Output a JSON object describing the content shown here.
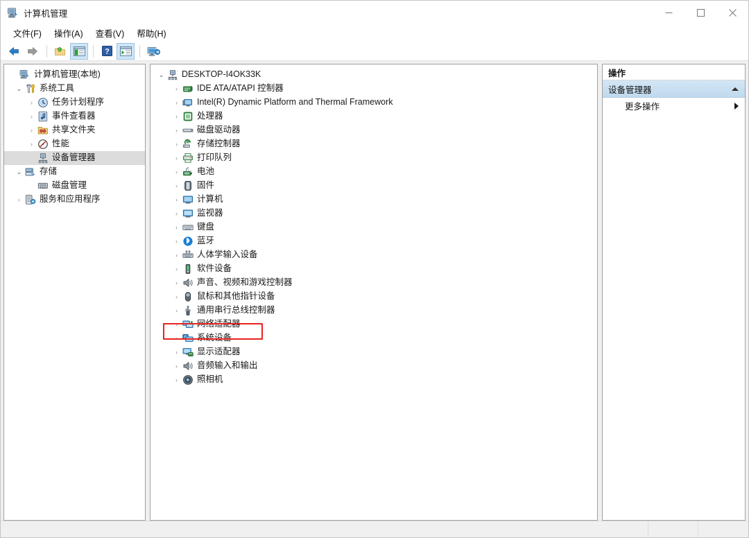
{
  "window": {
    "title": "计算机管理",
    "app_icon": "computer-management-icon",
    "controls": {
      "minimize": "–",
      "maximize": "□",
      "close": "✕"
    }
  },
  "menubar": {
    "items": [
      {
        "label": "文件(F)",
        "name": "menu-file"
      },
      {
        "label": "操作(A)",
        "name": "menu-action"
      },
      {
        "label": "查看(V)",
        "name": "menu-view"
      },
      {
        "label": "帮助(H)",
        "name": "menu-help"
      }
    ]
  },
  "toolbar": {
    "buttons": [
      {
        "name": "back-button",
        "icon": "arrow-left-icon",
        "pressed": false,
        "tip": "后退"
      },
      {
        "name": "forward-button",
        "icon": "arrow-right-icon",
        "pressed": false,
        "tip": "前进"
      },
      {
        "name": "up-level-button",
        "icon": "folder-up-icon",
        "pressed": false,
        "tip": "上移一级"
      },
      {
        "name": "show-hide-tree-button",
        "icon": "console-tree-icon",
        "pressed": true,
        "tip": "显示/隐藏控制台树"
      },
      {
        "name": "help-button",
        "icon": "help-question-icon",
        "pressed": false,
        "tip": "帮助"
      },
      {
        "name": "show-action-pane-button",
        "icon": "action-pane-icon",
        "pressed": true,
        "tip": "显示/隐藏操作窗格"
      },
      {
        "name": "remote-desktop-button",
        "icon": "remote-computer-icon",
        "pressed": false,
        "tip": "连接到另一台计算机"
      }
    ]
  },
  "console_tree": {
    "items": [
      {
        "label": "计算机管理(本地)",
        "icon": "computer-management-icon",
        "indent": 0,
        "state": "none",
        "selected": false
      },
      {
        "label": "系统工具",
        "icon": "system-tools-icon",
        "indent": 1,
        "state": "expanded",
        "selected": false
      },
      {
        "label": "任务计划程序",
        "icon": "task-scheduler-icon",
        "indent": 2,
        "state": "collapsed",
        "selected": false
      },
      {
        "label": "事件查看器",
        "icon": "event-viewer-icon",
        "indent": 2,
        "state": "collapsed",
        "selected": false
      },
      {
        "label": "共享文件夹",
        "icon": "shared-folders-icon",
        "indent": 2,
        "state": "collapsed",
        "selected": false
      },
      {
        "label": "性能",
        "icon": "performance-icon",
        "indent": 2,
        "state": "collapsed",
        "selected": false
      },
      {
        "label": "设备管理器",
        "icon": "device-manager-icon",
        "indent": 2,
        "state": "none",
        "selected": true
      },
      {
        "label": "存储",
        "icon": "storage-icon",
        "indent": 1,
        "state": "expanded",
        "selected": false
      },
      {
        "label": "磁盘管理",
        "icon": "disk-management-icon",
        "indent": 2,
        "state": "none",
        "selected": false
      },
      {
        "label": "服务和应用程序",
        "icon": "services-apps-icon",
        "indent": 1,
        "state": "collapsed",
        "selected": false
      }
    ]
  },
  "device_tree": {
    "root": {
      "label": "DESKTOP-I4OK33K",
      "icon": "computer-root-icon",
      "state": "expanded"
    },
    "items": [
      {
        "label": "IDE ATA/ATAPI 控制器",
        "icon": "ide-controller-icon",
        "state": "collapsed"
      },
      {
        "label": "Intel(R) Dynamic Platform and Thermal Framework",
        "icon": "thermal-framework-icon",
        "state": "collapsed"
      },
      {
        "label": "处理器",
        "icon": "processor-icon",
        "state": "collapsed"
      },
      {
        "label": "磁盘驱动器",
        "icon": "disk-drive-icon",
        "state": "collapsed"
      },
      {
        "label": "存储控制器",
        "icon": "storage-controller-icon",
        "state": "collapsed"
      },
      {
        "label": "打印队列",
        "icon": "print-queue-icon",
        "state": "collapsed"
      },
      {
        "label": "电池",
        "icon": "battery-icon",
        "state": "collapsed"
      },
      {
        "label": "固件",
        "icon": "firmware-icon",
        "state": "collapsed"
      },
      {
        "label": "计算机",
        "icon": "computer-icon",
        "state": "collapsed"
      },
      {
        "label": "监视器",
        "icon": "monitor-icon",
        "state": "collapsed"
      },
      {
        "label": "键盘",
        "icon": "keyboard-icon",
        "state": "collapsed"
      },
      {
        "label": "蓝牙",
        "icon": "bluetooth-icon",
        "state": "collapsed"
      },
      {
        "label": "人体学输入设备",
        "icon": "hid-icon",
        "state": "collapsed"
      },
      {
        "label": "软件设备",
        "icon": "software-device-icon",
        "state": "collapsed"
      },
      {
        "label": "声音、视频和游戏控制器",
        "icon": "sound-video-game-icon",
        "state": "collapsed"
      },
      {
        "label": "鼠标和其他指针设备",
        "icon": "mouse-icon",
        "state": "collapsed"
      },
      {
        "label": "通用串行总线控制器",
        "icon": "usb-controller-icon",
        "state": "collapsed"
      },
      {
        "label": "网络适配器",
        "icon": "network-adapter-icon",
        "state": "collapsed"
      },
      {
        "label": "系统设备",
        "icon": "system-devices-icon",
        "state": "collapsed",
        "annotated": true
      },
      {
        "label": "显示适配器",
        "icon": "display-adapter-icon",
        "state": "collapsed"
      },
      {
        "label": "音频输入和输出",
        "icon": "audio-io-icon",
        "state": "collapsed"
      },
      {
        "label": "照相机",
        "icon": "camera-icon",
        "state": "collapsed"
      }
    ]
  },
  "actions_pane": {
    "header": "操作",
    "group": {
      "label": "设备管理器",
      "collapse_icon": "triangle-up-icon"
    },
    "items": [
      {
        "label": "更多操作",
        "submenu_icon": "triangle-right-icon"
      }
    ]
  },
  "statusbar": {
    "cell1": "",
    "cell2": "",
    "cell3": ""
  },
  "colors": {
    "accent_blue": "#cfe6f7",
    "annotation_red": "#e8231f",
    "selection_gray": "#dcdcdc",
    "panel_border": "#a0a0a0"
  }
}
